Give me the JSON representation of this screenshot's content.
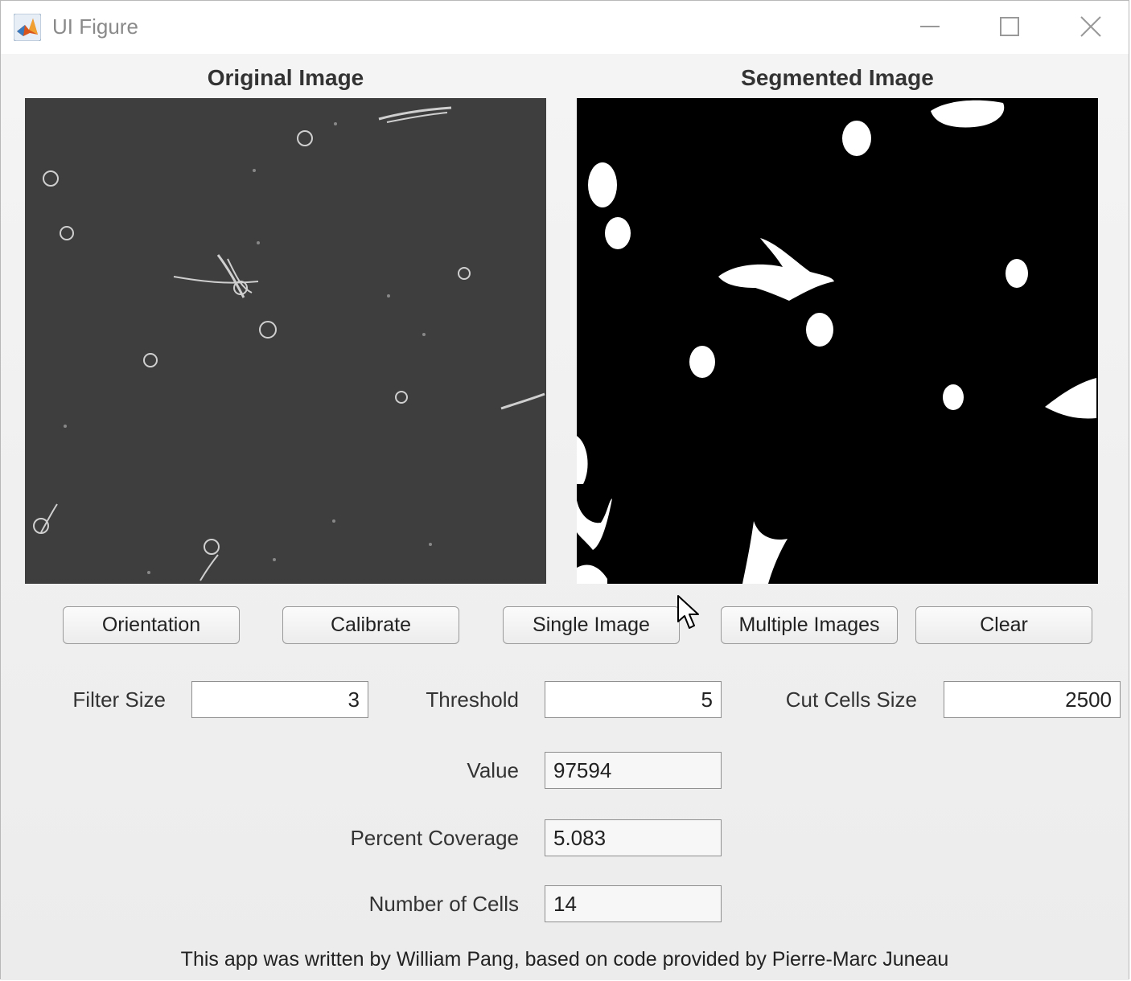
{
  "window": {
    "title": "UI Figure"
  },
  "panels": {
    "left_title": "Original Image",
    "right_title": "Segmented Image"
  },
  "buttons": {
    "orientation": "Orientation",
    "calibrate": "Calibrate",
    "single_image": "Single Image",
    "multiple_images": "Multiple Images",
    "clear": "Clear"
  },
  "params": {
    "filter_size_label": "Filter Size",
    "filter_size_value": "3",
    "threshold_label": "Threshold",
    "threshold_value": "5",
    "cut_cells_size_label": "Cut Cells Size",
    "cut_cells_size_value": "2500"
  },
  "results": {
    "value_label": "Value",
    "value": "97594",
    "percent_coverage_label": "Percent Coverage",
    "percent_coverage": "5.083",
    "number_of_cells_label": "Number of Cells",
    "number_of_cells": "14"
  },
  "footer": {
    "credit": "This app was written by William Pang, based on code provided by Pierre-Marc Juneau"
  },
  "icons": {
    "app": "matlab-logo-icon",
    "minimize": "minimize-icon",
    "maximize": "maximize-icon",
    "close": "close-icon",
    "cursor": "mouse-pointer-icon"
  },
  "colors": {
    "original_background": "#3d3d3d",
    "segmented_background": "#000000",
    "segmented_foreground": "#ffffff"
  }
}
